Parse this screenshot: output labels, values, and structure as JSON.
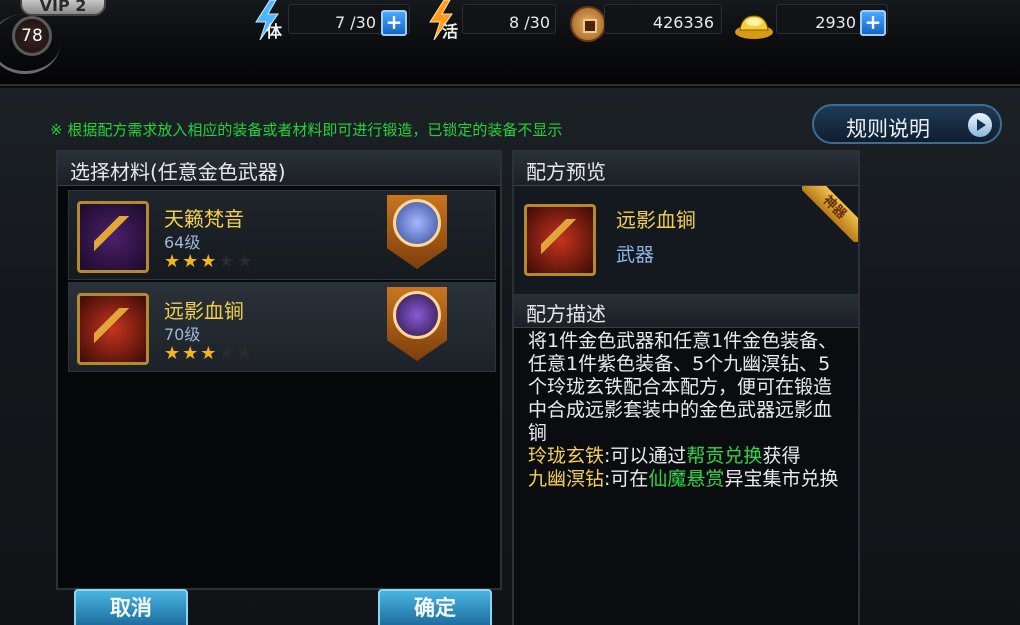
{
  "topbar": {
    "vip_label": "VIP 2",
    "player_level": "78",
    "stamina": {
      "label": "体",
      "value": "7 /30",
      "plus": "+"
    },
    "vitality": {
      "label": "活",
      "value": "8 /30"
    },
    "coins": {
      "value": "426336"
    },
    "gold": {
      "value": "2930",
      "plus": "+"
    }
  },
  "hint": "※ 根据配方需求放入相应的装备或者材料即可进行锻造，已锁定的装备不显示",
  "rules_button": "规则说明",
  "left_panel": {
    "title": "选择材料(任意金色武器)",
    "items": [
      {
        "name": "天籁梵音",
        "level": "64级",
        "stars_on": 3,
        "stars_total": 5
      },
      {
        "name": "远影血锏",
        "level": "70级",
        "stars_on": 3,
        "stars_total": 5
      }
    ]
  },
  "buttons": {
    "cancel": "取消",
    "confirm": "确定"
  },
  "right_panel": {
    "preview_title": "配方预览",
    "preview_item": {
      "name": "远影血锏",
      "type": "武器",
      "ribbon": "神器"
    },
    "desc_title": "配方描述",
    "desc_text": "将1件金色武器和任意1件金色装备、任意1件紫色装备、5个九幽溟钻、5个玲珑玄铁配合本配方，便可在锻造中合成远影套装中的金色武器远影血锏",
    "desc_lines": [
      {
        "key": "玲珑玄铁",
        "pre": ":可以通过",
        "link": "帮贡兑换",
        "post": "获得"
      },
      {
        "key": "九幽溟钻",
        "pre": ":可在",
        "link": "仙魔悬赏",
        "post": "异宝集市兑换"
      }
    ]
  },
  "colors": {
    "accent_gold": "#f2cf4a",
    "hint_green": "#23d23a",
    "button_blue": "#1b6a9a"
  }
}
